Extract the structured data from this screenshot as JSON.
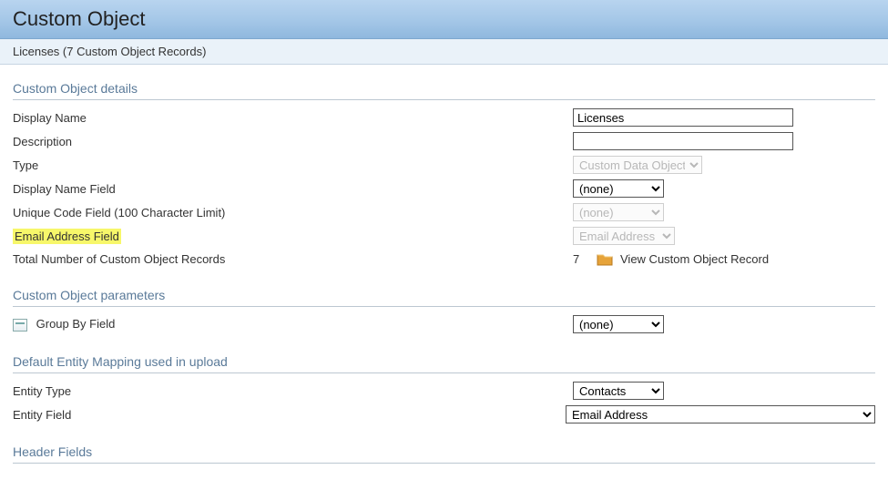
{
  "header": {
    "title": "Custom Object"
  },
  "subheader": {
    "text": "Licenses (7 Custom Object Records)"
  },
  "details": {
    "section_title": "Custom Object details",
    "rows": {
      "display_name": {
        "label": "Display Name",
        "value": "Licenses"
      },
      "description": {
        "label": "Description",
        "value": ""
      },
      "type": {
        "label": "Type",
        "value": "Custom Data Objects"
      },
      "display_name_field": {
        "label": "Display Name Field",
        "value": "(none)"
      },
      "unique_code": {
        "label": "Unique Code Field (100 Character Limit)",
        "value": "(none)"
      },
      "email_field": {
        "label": "Email Address Field",
        "value": "Email Address"
      },
      "total_records": {
        "label": "Total Number of Custom Object Records",
        "count": "7",
        "link": "View Custom Object Record"
      }
    }
  },
  "params": {
    "section_title": "Custom Object parameters",
    "group_by": {
      "label": "Group By Field",
      "value": "(none)"
    }
  },
  "mapping": {
    "section_title": "Default Entity Mapping used in upload",
    "entity_type": {
      "label": "Entity Type",
      "value": "Contacts"
    },
    "entity_field": {
      "label": "Entity Field",
      "value": "Email Address"
    }
  },
  "header_fields": {
    "section_title": "Header Fields"
  }
}
